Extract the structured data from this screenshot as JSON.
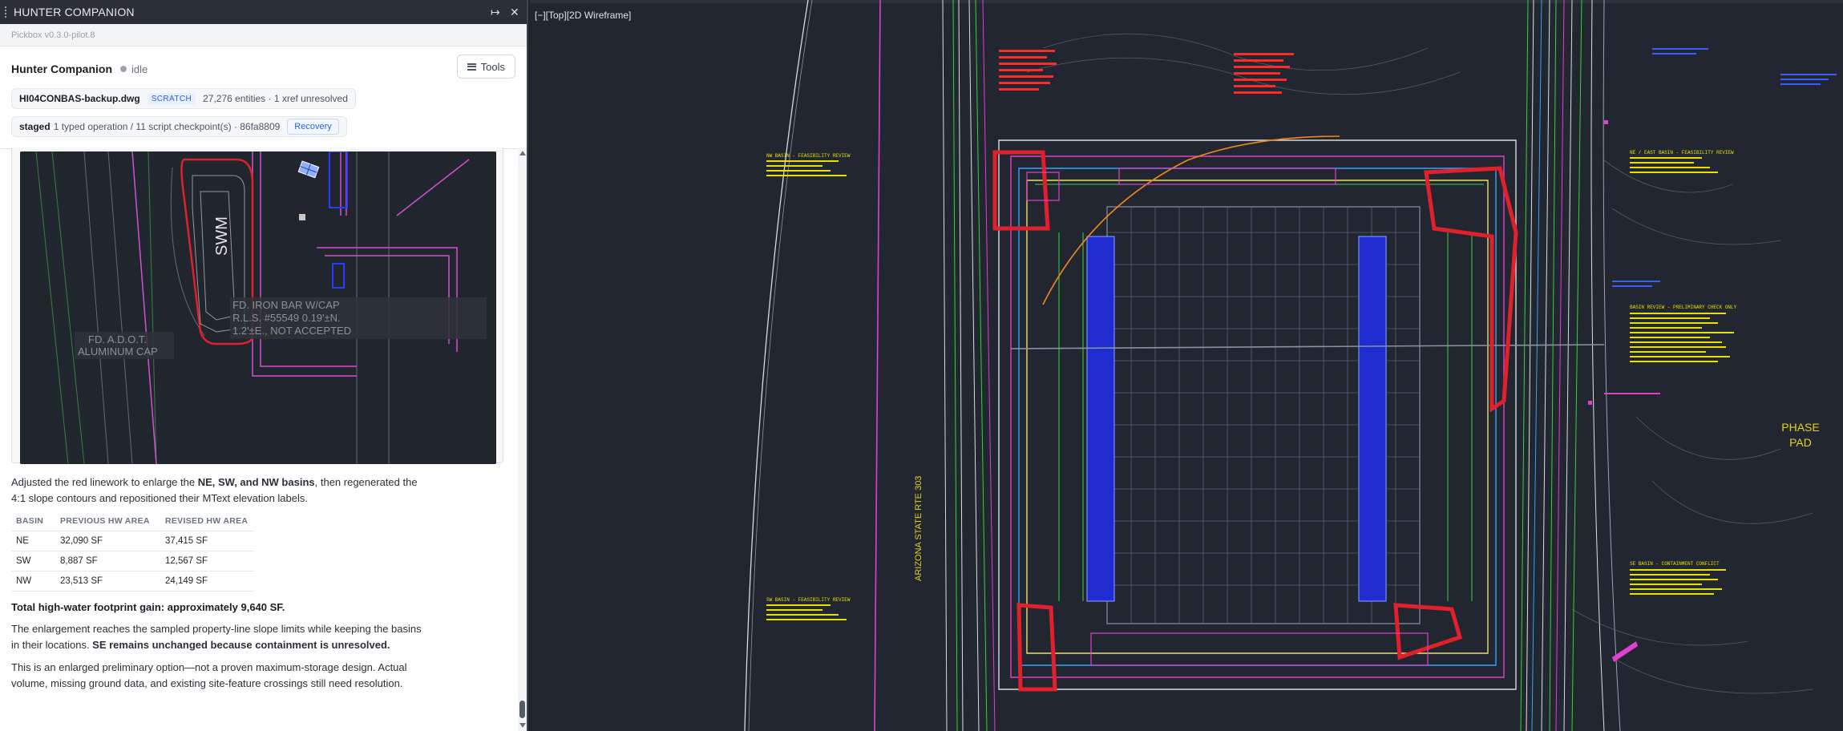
{
  "panel": {
    "title": "HUNTER COMPANION",
    "version": "Pickbox v0.3.0-pilot.8",
    "app_name": "Hunter Companion",
    "status": "idle",
    "tools_label": "Tools",
    "file": {
      "name": "HI04CONBAS-backup.dwg",
      "badge": "SCRATCH",
      "summary": "27,276 entities · 1 xref unresolved"
    },
    "staged": {
      "label": "staged",
      "summary": "1 typed operation / 11 script checkpoint(s) · 86fa8809",
      "recovery_label": "Recovery"
    }
  },
  "preview": {
    "labels": {
      "swm": "SWM",
      "iron_bar_1": "FD. IRON BAR W/CAP",
      "iron_bar_2": "R.L.S. #55549  0.19'±N.",
      "iron_bar_3": "1.2'±E., NOT ACCEPTED",
      "adot_1": "FD. A.D.O.T.",
      "adot_2": "ALUMINUM CAP"
    }
  },
  "message": {
    "p1_pre": "Adjusted the red linework to enlarge the ",
    "p1_bold": "NE, SW, and NW basins",
    "p1_post": ", then regenerated the 4:1 slope contours and repositioned their MText elevation labels.",
    "table": {
      "headers": [
        "BASIN",
        "PREVIOUS HW AREA",
        "REVISED HW AREA"
      ],
      "rows": [
        [
          "NE",
          "32,090 SF",
          "37,415 SF"
        ],
        [
          "SW",
          "8,887 SF",
          "12,567 SF"
        ],
        [
          "NW",
          "23,513 SF",
          "24,149 SF"
        ]
      ]
    },
    "total": "Total high-water footprint gain: approximately 9,640 SF.",
    "p2_pre": "The enlargement reaches the sampled property-line slope limits while keeping the basins in their locations. ",
    "p2_bold": "SE remains unchanged because containment is unresolved.",
    "p3": "This is an enlarged preliminary option—not a proven maximum-storage design. Actual volume, missing ground data, and existing site-feature crossings still need resolution."
  },
  "viewport": {
    "label": "[−][Top][2D Wireframe]",
    "road_label": "ARIZONA STATE RTE 303",
    "phase_1": "PHASE",
    "phase_2": "PAD",
    "nw_note": "NW BASIN - FEASIBILITY REVIEW",
    "ne_note": "NE / EAST BASIN - FEASIBILITY REVIEW",
    "sw_note": "SW BASIN - FEASIBILITY REVIEW",
    "se_note": "SE BASIN - CONTAINMENT CONFLICT",
    "basin_note": "BASIN REVIEW - PRELIMINARY CHECK ONLY"
  }
}
